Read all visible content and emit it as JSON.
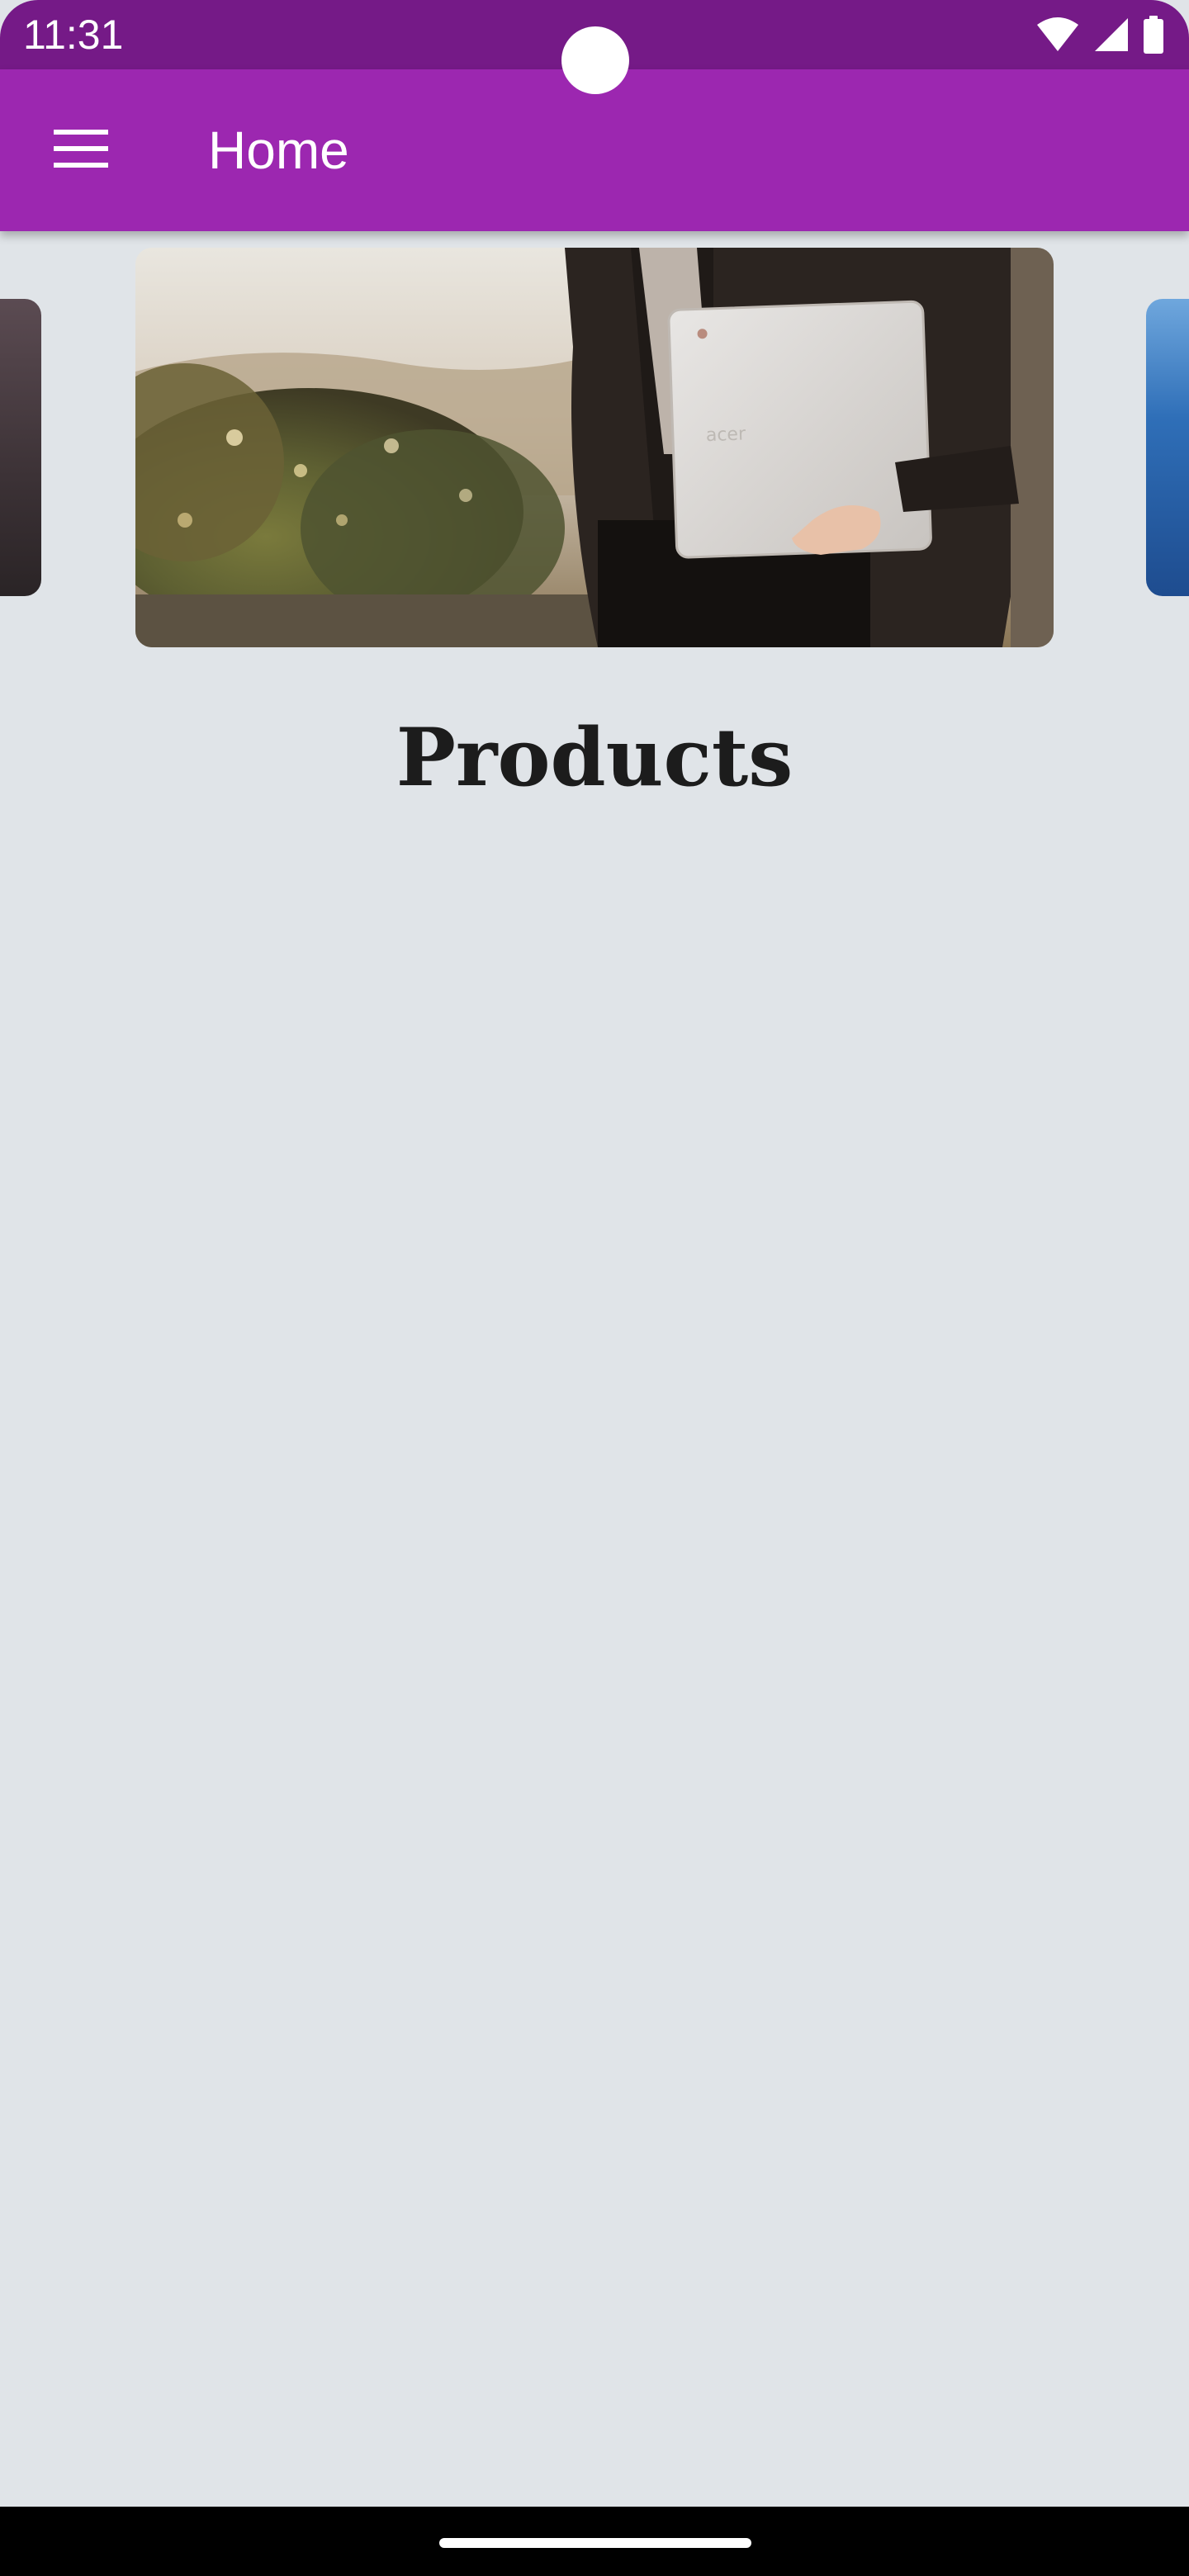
{
  "status_bar": {
    "time": "11:31",
    "icons": [
      "wifi-icon",
      "cellular-signal-icon",
      "battery-icon"
    ],
    "background": "#751A87"
  },
  "app_bar": {
    "title": "Home",
    "menu_icon": "menu-icon",
    "background": "#9C27B0"
  },
  "carousel": {
    "slides": [
      "slide-previous",
      "slide-current-person-holding-laptop",
      "slide-next"
    ]
  },
  "main": {
    "heading": "Products",
    "background": "#E0E4E8"
  }
}
